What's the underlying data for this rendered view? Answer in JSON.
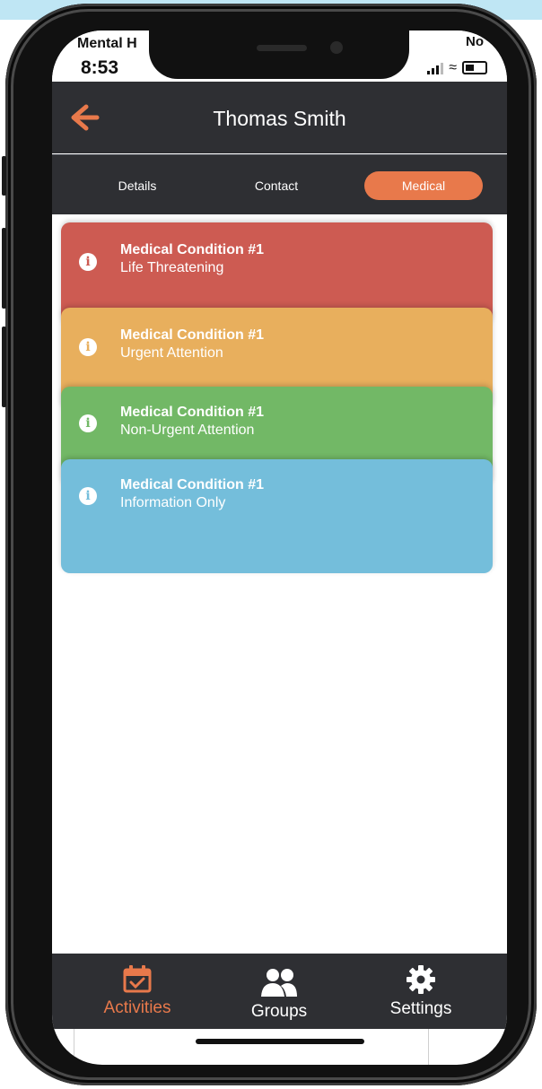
{
  "status": {
    "carrier": "Mental H",
    "network": "No",
    "time": "8:53"
  },
  "header": {
    "title": "Thomas Smith",
    "back_icon": "back-arrow-icon"
  },
  "tabs": [
    {
      "label": "Details",
      "active": false
    },
    {
      "label": "Contact",
      "active": false
    },
    {
      "label": "Medical",
      "active": true
    }
  ],
  "conditions": [
    {
      "title": "Medical Condition #1",
      "severity": "Life Threatening",
      "color": "#cd5b52"
    },
    {
      "title": "Medical Condition #1",
      "severity": "Urgent Attention",
      "color": "#e8af5d"
    },
    {
      "title": "Medical Condition #1",
      "severity": "Non-Urgent Attention",
      "color": "#72b866"
    },
    {
      "title": "Medical Condition #1",
      "severity": "Information Only",
      "color": "#74bedb"
    }
  ],
  "nav": [
    {
      "label": "Activities",
      "icon": "calendar-check-icon",
      "active": true
    },
    {
      "label": "Groups",
      "icon": "users-icon",
      "active": false
    },
    {
      "label": "Settings",
      "icon": "gear-icon",
      "active": false
    }
  ],
  "colors": {
    "accent": "#e8794b",
    "bar": "#2e2f33"
  }
}
